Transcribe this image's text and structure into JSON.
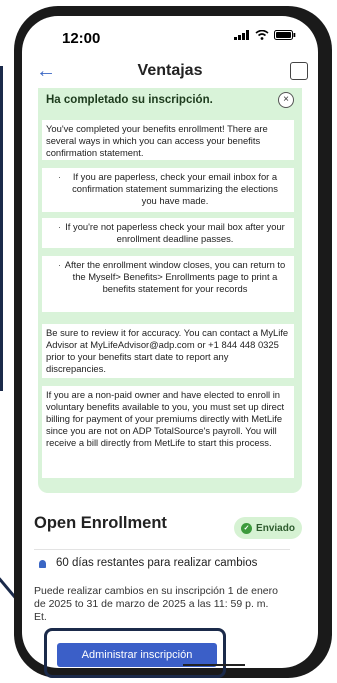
{
  "status": {
    "time": "12:00"
  },
  "header": {
    "title": "Ventajas"
  },
  "alert": {
    "title": "Ha completado su inscripción.",
    "close": "×",
    "intro": "You've completed your benefits enrollment! There are several ways in which you can access your benefits confirmation statement.",
    "bullets": [
      "If you are paperless, check your email inbox for a confirmation statement summarizing the elections you have made.",
      "If you're not paperless check your mail box after your enrollment deadline passes.",
      "After the enrollment window closes, you can return to the Myself> Benefits> Enrollments page to print a benefits statement for your records"
    ],
    "bullet_mark": "·",
    "review": "Be sure to review it for accuracy. You can contact a MyLife Advisor at MyLifeAdvisor@adp.com or +1 844 448 0325 prior to your benefits start date to report any discrepancies.",
    "nonpaid": "If you are a non-paid owner and have elected to enroll in voluntary benefits available to you, you must set up direct billing for payment of your premiums directly with MetLife since you are not on ADP TotalSource's payroll. You will receive a bill directly from MetLife to start this process."
  },
  "enrollment": {
    "title": "Open Enrollment",
    "status": "Enviado",
    "days": "60 días restantes para realizar cambios",
    "info": "Puede realizar cambios en su inscripción 1 de enero de 2025 to 31 de marzo de 2025 a las 11: 59 p. m. Et.",
    "button": "Administrar inscripción"
  },
  "icons": {
    "back": "back-arrow-icon",
    "action": "share-icon",
    "bell": "bell-icon",
    "check": "check-circle-icon"
  },
  "colors": {
    "accent": "#3b5fc8",
    "panel": "#d9f3d9",
    "badge": "#d6f2d3"
  }
}
